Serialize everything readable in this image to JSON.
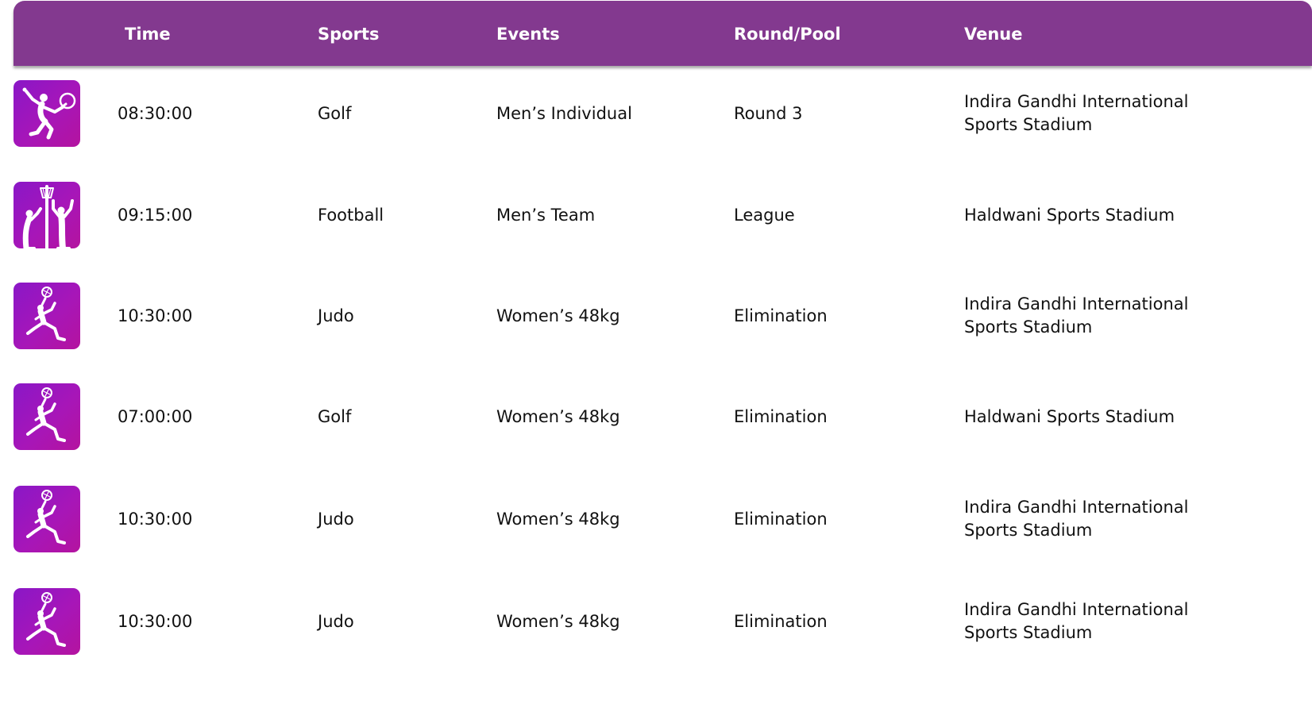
{
  "header": {
    "time": "Time",
    "sports": "Sports",
    "events": "Events",
    "round": "Round/Pool",
    "venue": "Venue"
  },
  "accent_color": "#83398f",
  "rows": [
    {
      "icon": "badminton-icon",
      "time": "08:30:00",
      "sport": "Golf",
      "event": "Men’s Individual",
      "round": "Round 3",
      "venue": "Indira Gandhi International Sports Stadium"
    },
    {
      "icon": "netball-icon",
      "time": "09:15:00",
      "sport": "Football",
      "event": "Men’s Team",
      "round": "League",
      "venue": "Haldwani Sports Stadium"
    },
    {
      "icon": "athlete-icon",
      "time": "10:30:00",
      "sport": "Judo",
      "event": "Women’s 48kg",
      "round": "Elimination",
      "venue": "Indira Gandhi International Sports Stadium"
    },
    {
      "icon": "athlete-icon",
      "time": "07:00:00",
      "sport": "Golf",
      "event": "Women’s 48kg",
      "round": "Elimination",
      "venue": "Haldwani Sports Stadium"
    },
    {
      "icon": "athlete-icon",
      "time": "10:30:00",
      "sport": "Judo",
      "event": "Women’s 48kg",
      "round": "Elimination",
      "venue": "Indira Gandhi International Sports Stadium"
    },
    {
      "icon": "athlete-icon",
      "time": "10:30:00",
      "sport": "Judo",
      "event": "Women’s 48kg",
      "round": "Elimination",
      "venue": "Indira Gandhi International Sports Stadium"
    }
  ]
}
